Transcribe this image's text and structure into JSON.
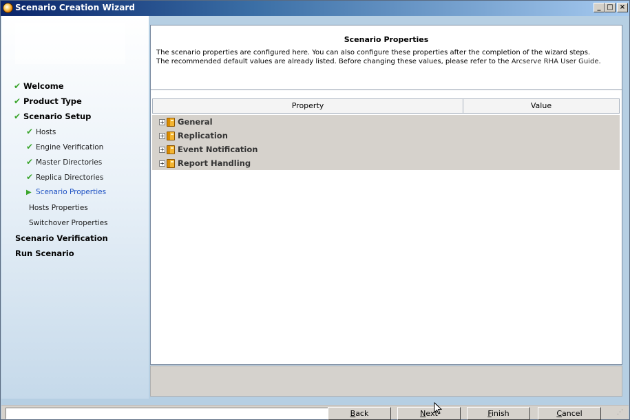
{
  "window": {
    "title": "Scenario Creation Wizard",
    "controls": {
      "minimize": "_",
      "maximize": "□",
      "close": "×"
    }
  },
  "nav": {
    "items": [
      {
        "label": "Welcome",
        "level": "top",
        "state": "done"
      },
      {
        "label": "Product Type",
        "level": "top",
        "state": "done"
      },
      {
        "label": "Scenario Setup",
        "level": "top",
        "state": "done"
      },
      {
        "label": "Hosts",
        "level": "sub",
        "state": "done"
      },
      {
        "label": "Engine Verification",
        "level": "sub",
        "state": "done"
      },
      {
        "label": "Master Directories",
        "level": "sub",
        "state": "done"
      },
      {
        "label": "Replica Directories",
        "level": "sub",
        "state": "done"
      },
      {
        "label": "Scenario Properties",
        "level": "sub",
        "state": "current"
      },
      {
        "label": "Hosts Properties",
        "level": "sub",
        "state": "pending"
      },
      {
        "label": "Switchover Properties",
        "level": "sub",
        "state": "pending"
      },
      {
        "label": "Scenario Verification",
        "level": "top",
        "state": "pending"
      },
      {
        "label": "Run Scenario",
        "level": "top",
        "state": "pending"
      }
    ]
  },
  "header": {
    "title": "Scenario Properties",
    "line1": "The scenario properties are configured here. You can also configure these properties after the completion of the wizard steps.",
    "line2": "The recommended default values are already listed. Before changing these values, please refer to the",
    "guide_link": "Arcserve RHA User Guide",
    "line2_end": "."
  },
  "grid": {
    "columns": {
      "property": "Property",
      "value": "Value"
    },
    "rows": [
      {
        "label": "General",
        "expander": "+"
      },
      {
        "label": "Replication",
        "expander": "+"
      },
      {
        "label": "Event Notification",
        "expander": "+"
      },
      {
        "label": "Report Handling",
        "expander": "+"
      }
    ]
  },
  "buttons": {
    "back": {
      "mnemonic": "B",
      "rest": "ack"
    },
    "next": {
      "mnemonic": "N",
      "rest": "ext"
    },
    "finish": {
      "mnemonic": "F",
      "rest": "inish"
    },
    "cancel": {
      "mnemonic": "C",
      "rest": "ancel"
    }
  },
  "colors": {
    "check": "#3aa52b",
    "current_step": "#1b4fc2",
    "grid_body": "#d6d2cc"
  }
}
